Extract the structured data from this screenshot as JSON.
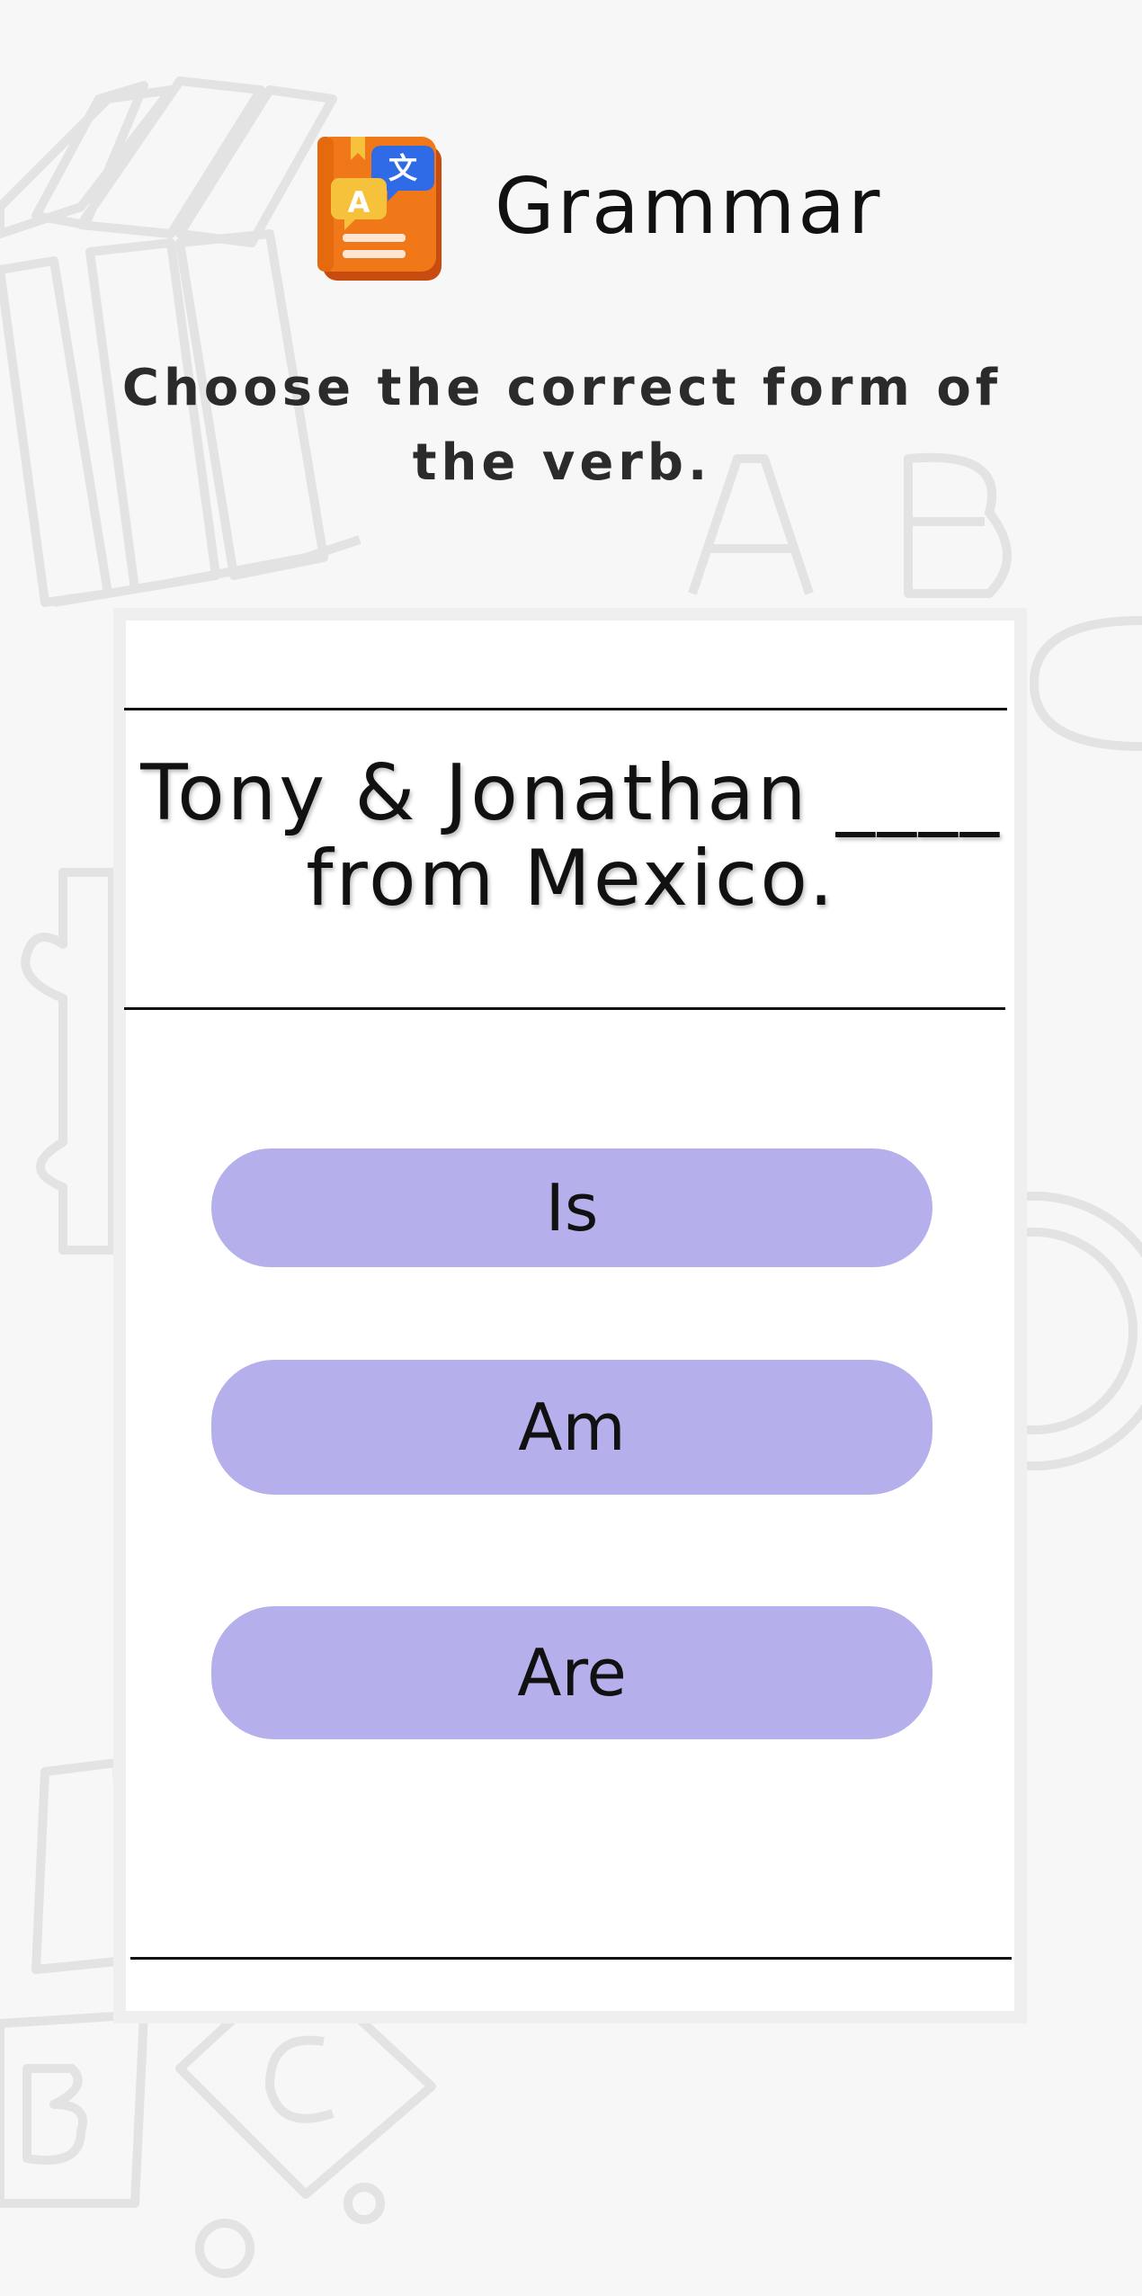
{
  "app": {
    "title": "Grammar",
    "icon": "translate-book-icon"
  },
  "instruction": "Choose the correct form of the verb.",
  "question": {
    "line1": "Tony & Jonathan ____",
    "line2": "from Mexico."
  },
  "options": [
    {
      "label": "Is"
    },
    {
      "label": "Am"
    },
    {
      "label": "Are"
    }
  ],
  "colors": {
    "background": "#f7f7f7",
    "option_fill": "#b5b0eb",
    "icon_book": "#f07818",
    "icon_bubble_blue": "#2f6be6",
    "icon_bubble_yellow": "#f6c23c",
    "deco_lines": "#e3e3e3"
  }
}
